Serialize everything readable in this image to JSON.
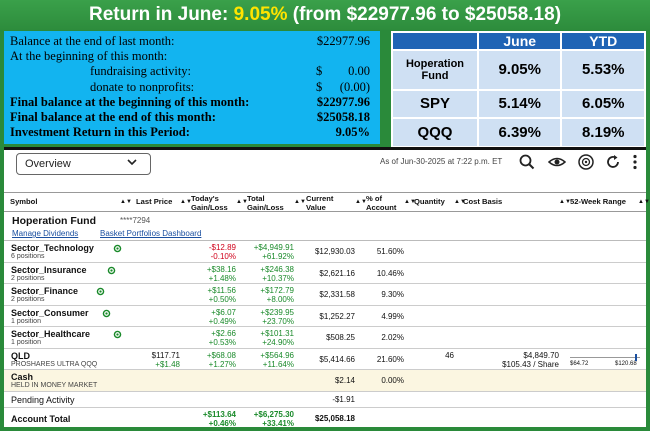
{
  "banner": {
    "prefix": "Return in June: ",
    "pct": "9.05%",
    "suffix": " (from $22977.96 to $25058.18)"
  },
  "summary": [
    {
      "label": "Balance at the end of last month:",
      "currency": "",
      "value": "$22977.96",
      "bold": false,
      "indent": false
    },
    {
      "label": "At the beginning of this month:",
      "currency": "",
      "value": "",
      "bold": false,
      "indent": false
    },
    {
      "label": "fundraising activity:",
      "currency": "$",
      "value": "0.00",
      "bold": false,
      "indent": true
    },
    {
      "label": "donate to nonprofits:",
      "currency": "$",
      "value": "(0.00)",
      "bold": false,
      "indent": true
    },
    {
      "label": "Final balance at the beginning of this month:",
      "currency": "",
      "value": "$22977.96",
      "bold": true,
      "indent": false
    },
    {
      "label": "Final balance at the end of this month:",
      "currency": "",
      "value": "$25058.18",
      "bold": true,
      "indent": false
    },
    {
      "label": "Investment Return in this Period:",
      "currency": "",
      "value": "9.05%",
      "bold": true,
      "indent": false
    }
  ],
  "returns": {
    "headers": [
      "",
      "June",
      "YTD"
    ],
    "rows": [
      {
        "name": "Hoperation Fund",
        "june": "9.05%",
        "ytd": "5.53%"
      },
      {
        "name": "SPY",
        "june": "5.14%",
        "ytd": "6.05%"
      },
      {
        "name": "QQQ",
        "june": "6.39%",
        "ytd": "8.19%"
      }
    ]
  },
  "toolbar": {
    "view_select": "Overview",
    "as_of": "As of Jun-30-2025 at 7:22 p.m. ET",
    "icons": [
      "search-icon",
      "eye-icon",
      "podcast-icon",
      "refresh-icon",
      "more-vertical-icon"
    ]
  },
  "columns": {
    "symbol": "Symbol",
    "last_price": "Last Price",
    "todays_gain": [
      "Today's",
      "Gain/Loss"
    ],
    "total_gain": [
      "Total",
      "Gain/Loss"
    ],
    "current_value": [
      "Current",
      "Value"
    ],
    "pct_account": [
      "% of",
      "Account"
    ],
    "quantity": "Quantity",
    "cost_basis": "Cost Basis",
    "range": "52-Week Range"
  },
  "account": {
    "name": "Hoperation Fund",
    "number": "****7294",
    "link1": "Manage Dividends",
    "link2": "Basket Portfolios Dashboard"
  },
  "rows": [
    {
      "name": "Sector_Technology",
      "sub": "6 positions",
      "last1": "",
      "last2": "",
      "today1": "-$12.89",
      "today2": "-0.10%",
      "todayNeg": true,
      "total1": "+$4,949.91",
      "total2": "+61.92%",
      "value": "$12,930.03",
      "pct": "51.60%",
      "qty": "",
      "cost1": "",
      "cost2": ""
    },
    {
      "name": "Sector_Insurance",
      "sub": "2 positions",
      "last1": "",
      "last2": "",
      "today1": "+$38.16",
      "today2": "+1.48%",
      "todayNeg": false,
      "total1": "+$246.38",
      "total2": "+10.37%",
      "value": "$2,621.16",
      "pct": "10.46%",
      "qty": "",
      "cost1": "",
      "cost2": ""
    },
    {
      "name": "Sector_Finance",
      "sub": "2 positions",
      "last1": "",
      "last2": "",
      "today1": "+$11.56",
      "today2": "+0.50%",
      "todayNeg": false,
      "total1": "+$172.79",
      "total2": "+8.00%",
      "value": "$2,331.58",
      "pct": "9.30%",
      "qty": "",
      "cost1": "",
      "cost2": ""
    },
    {
      "name": "Sector_Consumer",
      "sub": "1 position",
      "last1": "",
      "last2": "",
      "today1": "+$6.07",
      "today2": "+0.49%",
      "todayNeg": false,
      "total1": "+$239.95",
      "total2": "+23.70%",
      "value": "$1,252.27",
      "pct": "4.99%",
      "qty": "",
      "cost1": "",
      "cost2": ""
    },
    {
      "name": "Sector_Healthcare",
      "sub": "1 position",
      "last1": "",
      "last2": "",
      "today1": "+$2.66",
      "today2": "+0.53%",
      "todayNeg": false,
      "total1": "+$101.31",
      "total2": "+24.90%",
      "value": "$508.25",
      "pct": "2.02%",
      "qty": "",
      "cost1": "",
      "cost2": ""
    }
  ],
  "qld": {
    "name": "QLD",
    "sub": "PROSHARES ULTRA QQQ",
    "last1": "$117.71",
    "last2": "+$1.48",
    "today1": "+$68.08",
    "today2": "+1.27%",
    "total1": "+$564.96",
    "total2": "+11.64%",
    "value": "$5,414.66",
    "pct": "21.60%",
    "qty": "46",
    "cost1": "$4,849.70",
    "cost2": "$105.43 / Share",
    "range_low": "$64.72",
    "range_high": "$120.68",
    "range_position": 0.95
  },
  "cash": {
    "name": "Cash",
    "sub": "HELD IN MONEY MARKET",
    "value": "$2.14",
    "pct": "0.00%"
  },
  "pending": {
    "name": "Pending Activity",
    "value": "-$1.91"
  },
  "total": {
    "name": "Account Total",
    "today1": "+$113.64",
    "today2": "+0.46%",
    "total1": "+$6,275.30",
    "total2": "+33.41%",
    "value": "$25,058.18"
  },
  "colors": {
    "banner": "#2d8c3c",
    "summary_bg": "#12b4f0",
    "header_blue": "#1f64b5",
    "cell_blue": "#cfe0f3",
    "gain": "#1a8a2a",
    "loss": "#d0021b",
    "cash_bg": "#fbf6e1"
  }
}
